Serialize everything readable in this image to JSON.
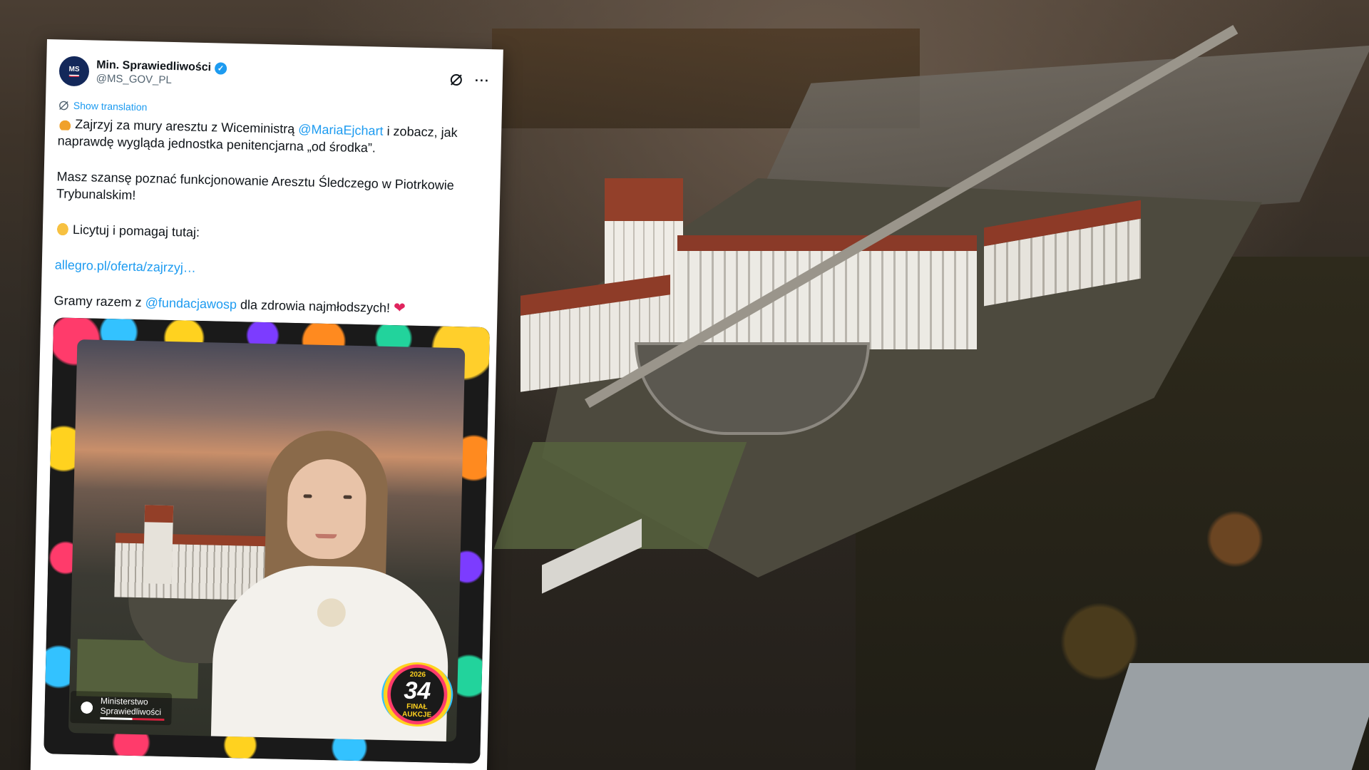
{
  "tweet": {
    "display_name": "Min. Sprawiedliwości",
    "handle": "@MS_GOV_PL",
    "avatar_text": "MS",
    "show_translation": "Show translation",
    "p1_a": "Zajrzyj za mury aresztu z Wiceministrą ",
    "p1_mention": "@MariaEjchart",
    "p1_b": " i zobacz, jak naprawdę wygląda jednostka penitencjarna „od środka”.",
    "p2": "Masz szansę poznać funkcjonowanie Aresztu Śledczego w Piotrkowie Trybunalskim!",
    "p3": "Licytuj i pomagaj tutaj:",
    "link": "allegro.pl/oferta/zajrzyj…",
    "p5_a": "Gramy razem z ",
    "p5_mention": "@fundacjawosp",
    "p5_b": " dla zdrowia najmłodszych! ",
    "heart": "❤"
  },
  "media": {
    "ms_logo_line1": "Ministerstwo",
    "ms_logo_line2": "Sprawiedliwości",
    "badge_year": "2026",
    "badge_number": "34",
    "badge_line1": "FINAŁ",
    "badge_line2": "AUKCJE"
  },
  "icons": {
    "verified": "verified-badge-icon",
    "grok": "grok-icon",
    "more": "more-icon",
    "translate": "globe-icon"
  },
  "colors": {
    "link": "#1d9bf0",
    "heart": "#e0245e",
    "roof": "#8a3a28"
  }
}
